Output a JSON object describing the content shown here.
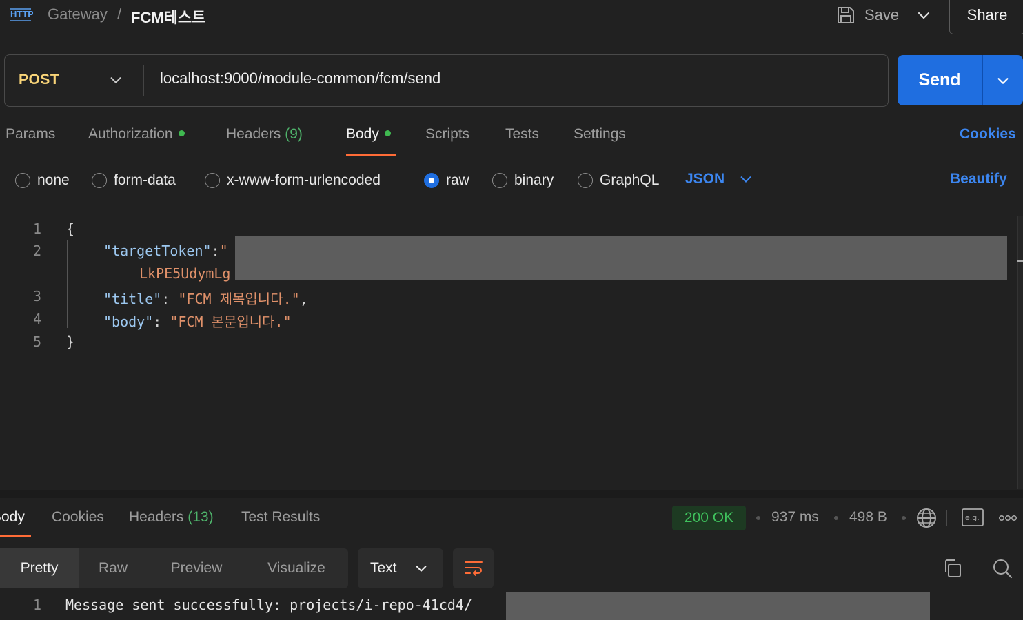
{
  "header": {
    "breadcrumb_parent": "Gateway",
    "breadcrumb_sep": "/",
    "breadcrumb_current": "FCM테스트",
    "save_label": "Save",
    "share_label": "Share"
  },
  "request": {
    "method": "POST",
    "url": "localhost:9000/module-common/fcm/send",
    "send_label": "Send"
  },
  "request_tabs": {
    "params": "Params",
    "authorization": "Authorization",
    "headers": "Headers",
    "headers_count": "(9)",
    "body": "Body",
    "scripts": "Scripts",
    "tests": "Tests",
    "settings": "Settings",
    "cookies": "Cookies"
  },
  "body_types": {
    "none": "none",
    "form_data": "form-data",
    "urlencoded": "x-www-form-urlencoded",
    "raw": "raw",
    "binary": "binary",
    "graphql": "GraphQL",
    "selected": "raw",
    "format": "JSON",
    "beautify": "Beautify"
  },
  "editor": {
    "line_numbers": [
      "1",
      "2",
      "3",
      "4",
      "5"
    ],
    "open_brace": "{",
    "close_brace": "}",
    "token_key": "\"targetToken\"",
    "token_colon": ":",
    "token_quote": "\"",
    "token_cont": "LkPE5UdymLg",
    "title_key": "\"title\"",
    "title_value": "\"FCM 제목입니다.\"",
    "body_key": "\"body\"",
    "body_value": "\"FCM 본문입니다.\""
  },
  "response": {
    "tabs": {
      "body": "Body",
      "cookies": "Cookies",
      "headers": "Headers",
      "headers_count": "(13)",
      "test_results": "Test Results"
    },
    "status": "200 OK",
    "time": "937 ms",
    "size": "498 B",
    "view_tabs": [
      "Pretty",
      "Raw",
      "Preview",
      "Visualize"
    ],
    "format": "Text",
    "line_number": "1",
    "line_text": "Message sent successfully: projects/i-repo-41cd4/"
  },
  "colors": {
    "accent": "#ff6c37",
    "primary": "#1f6ee0",
    "link": "#3c86f0",
    "success": "#3fb950",
    "method": "#f8d478"
  }
}
